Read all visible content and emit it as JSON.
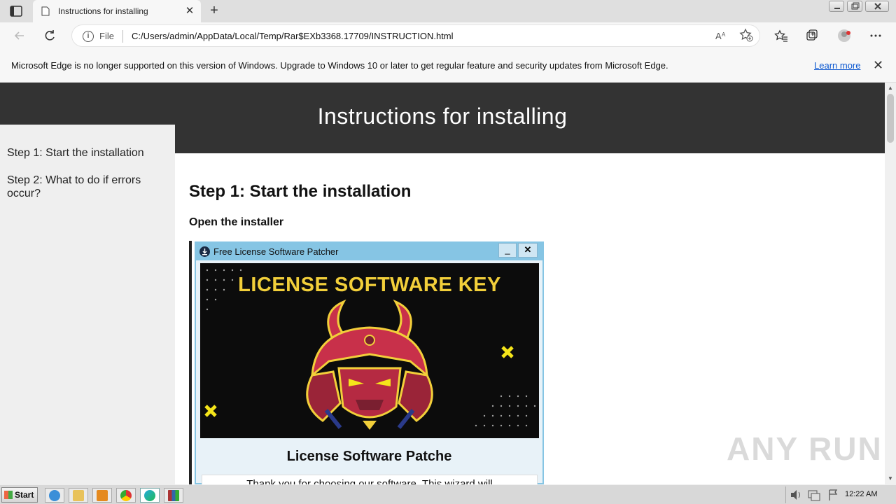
{
  "browser": {
    "tab_title": "Instructions for installing",
    "new_tab": "+",
    "tab_close": "✕",
    "scheme_label": "File",
    "url": "C:/Users/admin/AppData/Local/Temp/Rar$EXb3368.17709/INSTRUCTION.html",
    "read_aloud": "Aͅ",
    "infobar": {
      "message": "Microsoft Edge is no longer supported on this version of Windows. Upgrade to Windows 10 or later to get regular feature and security updates from Microsoft Edge.",
      "link": "Learn more",
      "close": "✕"
    }
  },
  "page": {
    "header_title": "Instructions for installing",
    "sidebar": [
      {
        "label": "Step 1: Start the installation"
      },
      {
        "label": "Step 2: What to do if errors occur?"
      }
    ],
    "step_title": "Step 1: Start the installation",
    "step_subtitle": "Open the installer",
    "installer": {
      "window_title": "Free License Software Patcher",
      "min": "_",
      "close": "✕",
      "banner_title": "LICENSE SOFTWARE KEY",
      "heading": "License Software Patche",
      "body": "Thank you for choosing our software. This wizard will"
    }
  },
  "watermark": "ANY RUN",
  "taskbar": {
    "start_label": "Start",
    "clock": "12:22 AM"
  },
  "colors": {
    "header_bg": "#333333",
    "sidebar_bg": "#efefef",
    "banner_title": "#f2cf3a",
    "installer_frame": "#86c5e4"
  }
}
